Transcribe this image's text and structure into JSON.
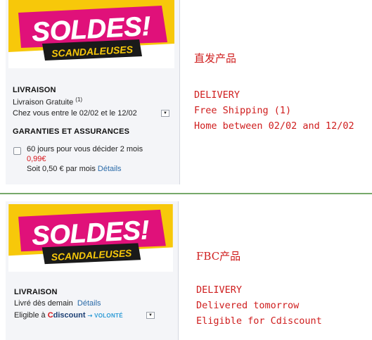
{
  "colors": {
    "accent_red": "#cf1d1d",
    "banner_pink": "#e0117a",
    "banner_yellow": "#f7c80a",
    "link_blue": "#2a6aa8",
    "divider_green": "#77a96b"
  },
  "banner": {
    "title": "SOLDES!",
    "subtitle": "SCANDALEUSES"
  },
  "top": {
    "delivery_title": "LIVRAISON",
    "shipping_label": "Livraison Gratuite",
    "shipping_note": "(1)",
    "home_dates": "Chez vous entre le 02/02 et le 12/02",
    "warranty_title": "GARANTIES ET ASSURANCES",
    "warranty_option": "60 jours pour vous décider 2 mois",
    "warranty_price": "0,99€",
    "warranty_monthly": "Soit 0,50 € par mois",
    "details_link": "Détails"
  },
  "bottom": {
    "delivery_title": "LIVRAISON",
    "delivery_text": "Livré dès demain",
    "details_link": "Détails",
    "eligible_text": "Eligible à",
    "cdiscount_c": "C",
    "cdiscount_rest": "discount",
    "volonte": "⇢ VOLONTÉ"
  },
  "annotations": {
    "top_heading": "直发产品",
    "top_lines": [
      "DELIVERY",
      "Free Shipping (1)",
      "Home between 02/02 and 12/02"
    ],
    "bottom_heading": "FBC产品",
    "bottom_lines": [
      "DELIVERY",
      "Delivered tomorrow",
      "Eligible for Cdiscount"
    ]
  },
  "icons": {
    "dropdown": "chevron-down-icon",
    "checkbox": "checkbox-icon"
  }
}
